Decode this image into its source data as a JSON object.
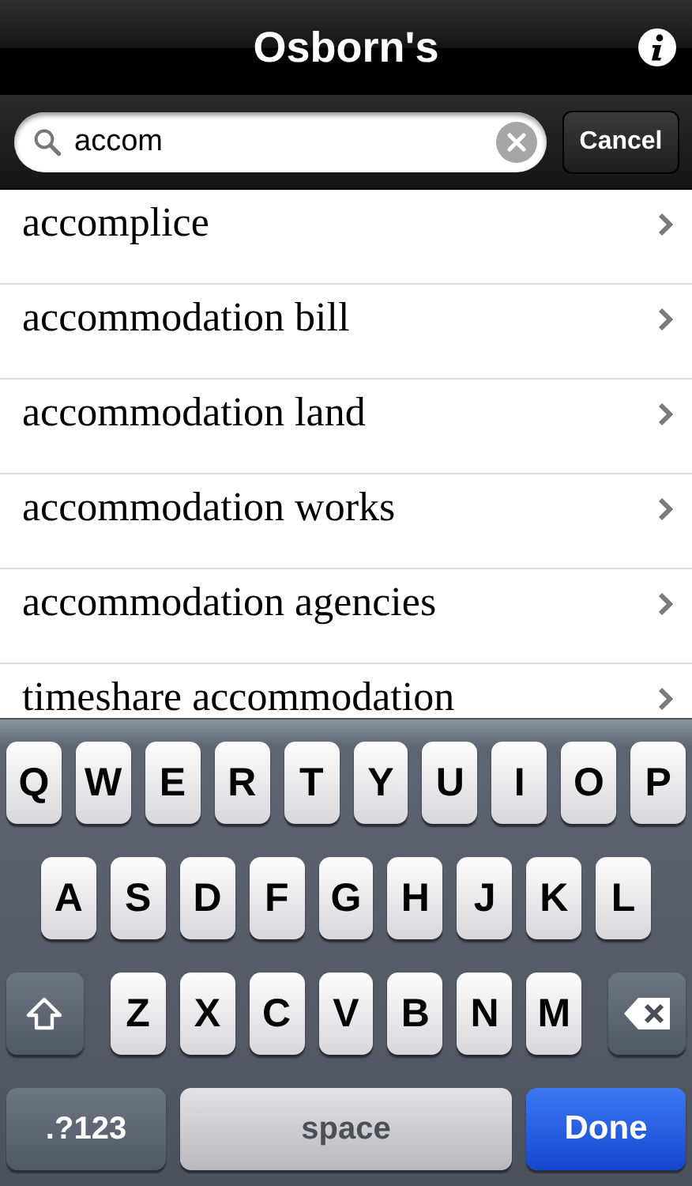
{
  "nav_bar": {
    "title": "Osborn's"
  },
  "search_bar": {
    "value": "accom",
    "cancel": "Cancel"
  },
  "results": [
    {
      "label": "accomplice"
    },
    {
      "label": "accommodation bill"
    },
    {
      "label": "accommodation land"
    },
    {
      "label": "accommodation works"
    },
    {
      "label": "accommodation agencies"
    },
    {
      "label": "timeshare accommodation"
    }
  ],
  "keyboard": {
    "rows": [
      {
        "keys": [
          {
            "kind": "letter",
            "label": "Q"
          },
          {
            "kind": "letter",
            "label": "W"
          },
          {
            "kind": "letter",
            "label": "E"
          },
          {
            "kind": "letter",
            "label": "R"
          },
          {
            "kind": "letter",
            "label": "T"
          },
          {
            "kind": "letter",
            "label": "Y"
          },
          {
            "kind": "letter",
            "label": "U"
          },
          {
            "kind": "letter",
            "label": "I"
          },
          {
            "kind": "letter",
            "label": "O"
          },
          {
            "kind": "letter",
            "label": "P"
          }
        ]
      },
      {
        "keys": [
          {
            "kind": "letter",
            "label": "A"
          },
          {
            "kind": "letter",
            "label": "S"
          },
          {
            "kind": "letter",
            "label": "D"
          },
          {
            "kind": "letter",
            "label": "F"
          },
          {
            "kind": "letter",
            "label": "G"
          },
          {
            "kind": "letter",
            "label": "H"
          },
          {
            "kind": "letter",
            "label": "J"
          },
          {
            "kind": "letter",
            "label": "K"
          },
          {
            "kind": "letter",
            "label": "L"
          }
        ]
      },
      {
        "keys": [
          {
            "kind": "shift"
          },
          {
            "kind": "letter",
            "label": "Z"
          },
          {
            "kind": "letter",
            "label": "X"
          },
          {
            "kind": "letter",
            "label": "C"
          },
          {
            "kind": "letter",
            "label": "V"
          },
          {
            "kind": "letter",
            "label": "B"
          },
          {
            "kind": "letter",
            "label": "N"
          },
          {
            "kind": "letter",
            "label": "M"
          },
          {
            "kind": "delete"
          }
        ]
      },
      {
        "keys": [
          {
            "kind": "mode",
            "label": ".?123"
          },
          {
            "kind": "space",
            "label": "space"
          },
          {
            "kind": "done",
            "label": "Done"
          }
        ]
      }
    ]
  }
}
